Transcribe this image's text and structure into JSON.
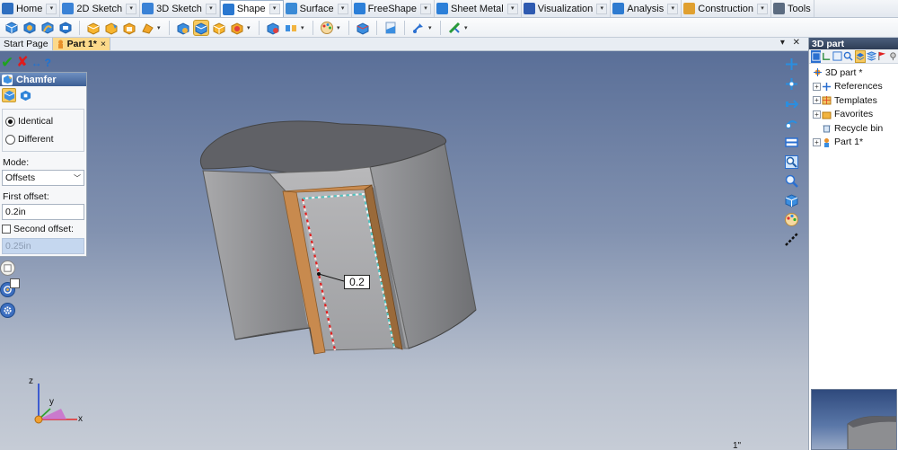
{
  "menu": {
    "tabs": [
      {
        "label": "Home",
        "color": "#2f6fc0",
        "active": false
      },
      {
        "label": "2D Sketch",
        "color": "#3a82d6",
        "active": false
      },
      {
        "label": "3D Sketch",
        "color": "#3a82d6",
        "active": false
      },
      {
        "label": "Shape",
        "color": "#2a78d0",
        "active": true
      },
      {
        "label": "Surface",
        "color": "#3a8ad6",
        "active": false
      },
      {
        "label": "FreeShape",
        "color": "#2c7fd8",
        "active": false
      },
      {
        "label": "Sheet Metal",
        "color": "#2c7fd8",
        "active": false
      },
      {
        "label": "Visualization",
        "color": "#2e5ab0",
        "active": false
      },
      {
        "label": "Analysis",
        "color": "#2e7bd0",
        "active": false
      },
      {
        "label": "Construction",
        "color": "#e0a030",
        "active": false
      },
      {
        "label": "Tools",
        "color": "#5b6b80",
        "active": false
      }
    ]
  },
  "doc_tabs": {
    "start_page": "Start Page",
    "part": "Part 1*",
    "close_glyph": "×",
    "controls": "▾ ✕"
  },
  "chamfer_panel": {
    "title": "Chamfer",
    "option_identical": "Identical",
    "option_different": "Different",
    "selected_option": "Identical",
    "mode_label": "Mode:",
    "mode_value": "Offsets",
    "first_offset_label": "First offset:",
    "first_offset_value": "0.2in",
    "second_offset_label": "Second offset:",
    "second_offset_checked": false,
    "second_offset_value": "0.25in"
  },
  "viewport": {
    "dimension_label": "0.2",
    "axis_x": "x",
    "axis_y": "y",
    "axis_z": "z",
    "corner_hint": "1\""
  },
  "right_pane": {
    "title": "3D part",
    "tree": [
      {
        "label": "3D part *",
        "expander": "",
        "icon": "part-root-icon"
      },
      {
        "label": "References",
        "expander": "+",
        "icon": "references-icon"
      },
      {
        "label": "Templates",
        "expander": "+",
        "icon": "templates-icon"
      },
      {
        "label": "Favorites",
        "expander": "+",
        "icon": "favorites-icon"
      },
      {
        "label": "Recycle bin",
        "expander": "",
        "icon": "recycle-bin-icon"
      },
      {
        "label": "Part 1*",
        "expander": "+",
        "icon": "part-icon"
      }
    ]
  },
  "colors": {
    "accent": "#f7c95f",
    "panel_header": "#3d5f95",
    "viewport_top": "#5a6f98",
    "chamfer_face": "#c88a4e",
    "edge_red": "#e02020",
    "edge_teal": "#4fc3c0"
  }
}
